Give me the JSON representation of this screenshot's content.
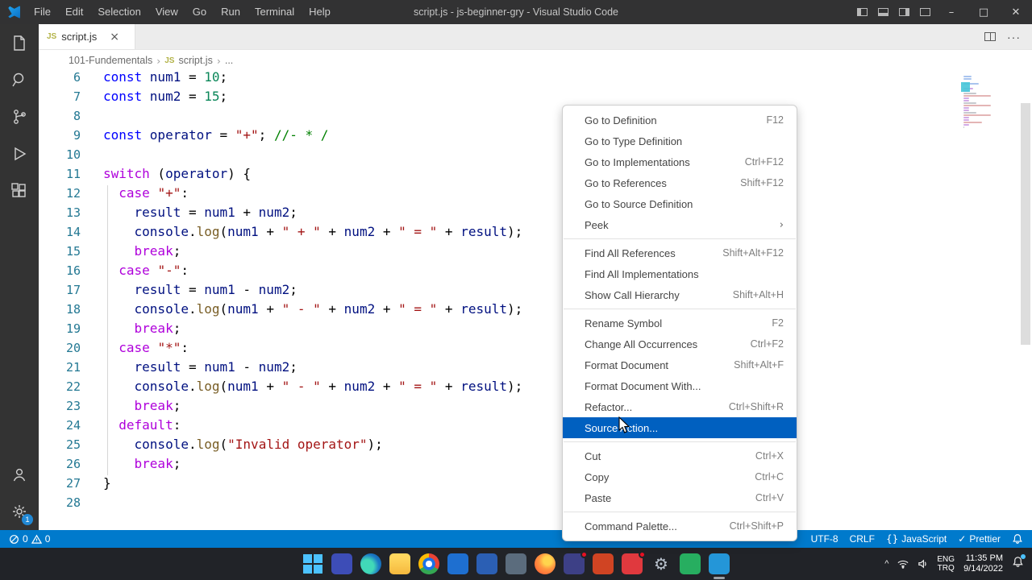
{
  "title_bar": {
    "menus": [
      "File",
      "Edit",
      "Selection",
      "View",
      "Go",
      "Run",
      "Terminal",
      "Help"
    ],
    "title": "script.js - js-beginner-gry - Visual Studio Code"
  },
  "tab_bar": {
    "tabs": [
      {
        "label": "script.js",
        "icon": "JS"
      }
    ]
  },
  "breadcrumb": {
    "folder": "101-Fundementals",
    "file": "script.js",
    "file_icon": "JS",
    "more": "..."
  },
  "activity_bar": {
    "settings_badge": "1"
  },
  "editor": {
    "lines": [
      {
        "n": "6",
        "tokens": [
          [
            "k",
            "const "
          ],
          [
            "v",
            "num1"
          ],
          [
            "p",
            " = "
          ],
          [
            "n",
            "10"
          ],
          [
            "p",
            ";"
          ]
        ]
      },
      {
        "n": "7",
        "tokens": [
          [
            "k",
            "const "
          ],
          [
            "v",
            "num2"
          ],
          [
            "p",
            " = "
          ],
          [
            "n",
            "15"
          ],
          [
            "p",
            ";"
          ]
        ]
      },
      {
        "n": "8",
        "tokens": []
      },
      {
        "n": "9",
        "tokens": [
          [
            "k",
            "const "
          ],
          [
            "v",
            "operator"
          ],
          [
            "p",
            " = "
          ],
          [
            "s",
            "\"+\""
          ],
          [
            "p",
            "; "
          ],
          [
            "m",
            "//- * /"
          ]
        ]
      },
      {
        "n": "10",
        "tokens": []
      },
      {
        "n": "11",
        "tokens": [
          [
            "c",
            "switch"
          ],
          [
            "p",
            " ("
          ],
          [
            "v",
            "operator"
          ],
          [
            "p",
            ") {"
          ]
        ]
      },
      {
        "n": "12",
        "tokens": [
          [
            "p",
            "  "
          ],
          [
            "c",
            "case "
          ],
          [
            "s",
            "\"+\""
          ],
          [
            "p",
            ":"
          ]
        ]
      },
      {
        "n": "13",
        "tokens": [
          [
            "p",
            "    "
          ],
          [
            "v",
            "result"
          ],
          [
            "p",
            " = "
          ],
          [
            "v",
            "num1"
          ],
          [
            "p",
            " + "
          ],
          [
            "v",
            "num2"
          ],
          [
            "p",
            ";"
          ]
        ]
      },
      {
        "n": "14",
        "tokens": [
          [
            "p",
            "    "
          ],
          [
            "v",
            "console"
          ],
          [
            "p",
            "."
          ],
          [
            "f",
            "log"
          ],
          [
            "p",
            "("
          ],
          [
            "v",
            "num1"
          ],
          [
            "p",
            " + "
          ],
          [
            "s",
            "\" + \""
          ],
          [
            "p",
            " + "
          ],
          [
            "v",
            "num2"
          ],
          [
            "p",
            " + "
          ],
          [
            "s",
            "\" = \""
          ],
          [
            "p",
            " + "
          ],
          [
            "v",
            "result"
          ],
          [
            "p",
            ");"
          ]
        ]
      },
      {
        "n": "15",
        "tokens": [
          [
            "p",
            "    "
          ],
          [
            "c",
            "break"
          ],
          [
            "p",
            ";"
          ]
        ]
      },
      {
        "n": "16",
        "tokens": [
          [
            "p",
            "  "
          ],
          [
            "c",
            "case "
          ],
          [
            "s",
            "\"-\""
          ],
          [
            "p",
            ":"
          ]
        ]
      },
      {
        "n": "17",
        "tokens": [
          [
            "p",
            "    "
          ],
          [
            "v",
            "result"
          ],
          [
            "p",
            " = "
          ],
          [
            "v",
            "num1"
          ],
          [
            "p",
            " - "
          ],
          [
            "v",
            "num2"
          ],
          [
            "p",
            ";"
          ]
        ]
      },
      {
        "n": "18",
        "tokens": [
          [
            "p",
            "    "
          ],
          [
            "v",
            "console"
          ],
          [
            "p",
            "."
          ],
          [
            "f",
            "log"
          ],
          [
            "p",
            "("
          ],
          [
            "v",
            "num1"
          ],
          [
            "p",
            " + "
          ],
          [
            "s",
            "\" - \""
          ],
          [
            "p",
            " + "
          ],
          [
            "v",
            "num2"
          ],
          [
            "p",
            " + "
          ],
          [
            "s",
            "\" = \""
          ],
          [
            "p",
            " + "
          ],
          [
            "v",
            "result"
          ],
          [
            "p",
            ");"
          ]
        ]
      },
      {
        "n": "19",
        "tokens": [
          [
            "p",
            "    "
          ],
          [
            "c",
            "break"
          ],
          [
            "p",
            ";"
          ]
        ]
      },
      {
        "n": "20",
        "tokens": [
          [
            "p",
            "  "
          ],
          [
            "c",
            "case "
          ],
          [
            "s",
            "\"*\""
          ],
          [
            "p",
            ":"
          ]
        ]
      },
      {
        "n": "21",
        "tokens": [
          [
            "p",
            "    "
          ],
          [
            "v",
            "result"
          ],
          [
            "p",
            " = "
          ],
          [
            "v",
            "num1"
          ],
          [
            "p",
            " - "
          ],
          [
            "v",
            "num2"
          ],
          [
            "p",
            ";"
          ]
        ]
      },
      {
        "n": "22",
        "tokens": [
          [
            "p",
            "    "
          ],
          [
            "v",
            "console"
          ],
          [
            "p",
            "."
          ],
          [
            "f",
            "log"
          ],
          [
            "p",
            "("
          ],
          [
            "v",
            "num1"
          ],
          [
            "p",
            " + "
          ],
          [
            "s",
            "\" - \""
          ],
          [
            "p",
            " + "
          ],
          [
            "v",
            "num2"
          ],
          [
            "p",
            " + "
          ],
          [
            "s",
            "\" = \""
          ],
          [
            "p",
            " + "
          ],
          [
            "v",
            "result"
          ],
          [
            "p",
            ");"
          ]
        ]
      },
      {
        "n": "23",
        "tokens": [
          [
            "p",
            "    "
          ],
          [
            "c",
            "break"
          ],
          [
            "p",
            ";"
          ]
        ]
      },
      {
        "n": "24",
        "tokens": [
          [
            "p",
            "  "
          ],
          [
            "c",
            "default"
          ],
          [
            "p",
            ":"
          ]
        ]
      },
      {
        "n": "25",
        "tokens": [
          [
            "p",
            "    "
          ],
          [
            "v",
            "console"
          ],
          [
            "p",
            "."
          ],
          [
            "f",
            "log"
          ],
          [
            "p",
            "("
          ],
          [
            "s",
            "\"Invalid operator\""
          ],
          [
            "p",
            ");"
          ]
        ]
      },
      {
        "n": "26",
        "tokens": [
          [
            "p",
            "    "
          ],
          [
            "c",
            "break"
          ],
          [
            "p",
            ";"
          ]
        ]
      },
      {
        "n": "27",
        "tokens": [
          [
            "p",
            "}"
          ]
        ]
      },
      {
        "n": "28",
        "tokens": []
      }
    ]
  },
  "context_menu": {
    "items": [
      {
        "label": "Go to Definition",
        "shortcut": "F12"
      },
      {
        "label": "Go to Type Definition",
        "shortcut": ""
      },
      {
        "label": "Go to Implementations",
        "shortcut": "Ctrl+F12"
      },
      {
        "label": "Go to References",
        "shortcut": "Shift+F12"
      },
      {
        "label": "Go to Source Definition",
        "shortcut": ""
      },
      {
        "label": "Peek",
        "submenu": true
      },
      {
        "separator": true
      },
      {
        "label": "Find All References",
        "shortcut": "Shift+Alt+F12"
      },
      {
        "label": "Find All Implementations",
        "shortcut": ""
      },
      {
        "label": "Show Call Hierarchy",
        "shortcut": "Shift+Alt+H"
      },
      {
        "separator": true
      },
      {
        "label": "Rename Symbol",
        "shortcut": "F2"
      },
      {
        "label": "Change All Occurrences",
        "shortcut": "Ctrl+F2"
      },
      {
        "label": "Format Document",
        "shortcut": "Shift+Alt+F"
      },
      {
        "label": "Format Document With...",
        "shortcut": ""
      },
      {
        "label": "Refactor...",
        "shortcut": "Ctrl+Shift+R"
      },
      {
        "label": "Source Action...",
        "shortcut": "",
        "highlighted": true
      },
      {
        "separator": true
      },
      {
        "label": "Cut",
        "shortcut": "Ctrl+X"
      },
      {
        "label": "Copy",
        "shortcut": "Ctrl+C"
      },
      {
        "label": "Paste",
        "shortcut": "Ctrl+V"
      },
      {
        "separator": true
      },
      {
        "label": "Command Palette...",
        "shortcut": "Ctrl+Shift+P"
      }
    ]
  },
  "status_bar": {
    "errors": "0",
    "warnings": "0",
    "encoding": "UTF-8",
    "eol": "CRLF",
    "language_icon": "{}",
    "language": "JavaScript",
    "formatter_check": "✓",
    "formatter": "Prettier"
  },
  "taskbar": {
    "icons": [
      {
        "name": "windows-start",
        "style": "start"
      },
      {
        "name": "teams",
        "color": "#3d4db7"
      },
      {
        "name": "edge",
        "style": "edge",
        "round": true
      },
      {
        "name": "file-explorer",
        "style": "folder"
      },
      {
        "name": "chrome",
        "style": "chrome",
        "round": true
      },
      {
        "name": "outlook",
        "color": "#1e6fd0"
      },
      {
        "name": "word",
        "color": "#2b5fb4"
      },
      {
        "name": "steam",
        "color": "#5b6c7d"
      },
      {
        "name": "firefox",
        "style": "firefox",
        "round": true
      },
      {
        "name": "discord",
        "color": "#3d4086",
        "badge": true
      },
      {
        "name": "powerpoint",
        "color": "#d04423"
      },
      {
        "name": "app-red",
        "color": "#e0393e",
        "badge": true
      },
      {
        "name": "settings",
        "style": "gear",
        "glyph": "⚙"
      },
      {
        "name": "whatsapp",
        "color": "#27ae60"
      },
      {
        "name": "vscode",
        "color": "#2496d8",
        "active": true
      }
    ],
    "tray": {
      "chevron": "^",
      "lang_line1": "ENG",
      "lang_line2": "TRQ",
      "time": "11:35 PM",
      "date": "9/14/2022"
    }
  },
  "icons": {
    "close_tab": "×",
    "ellipsis": "···",
    "chevron_right": "›",
    "submenu": "›",
    "minimize": "–",
    "maximize": "□",
    "close": "✕"
  }
}
